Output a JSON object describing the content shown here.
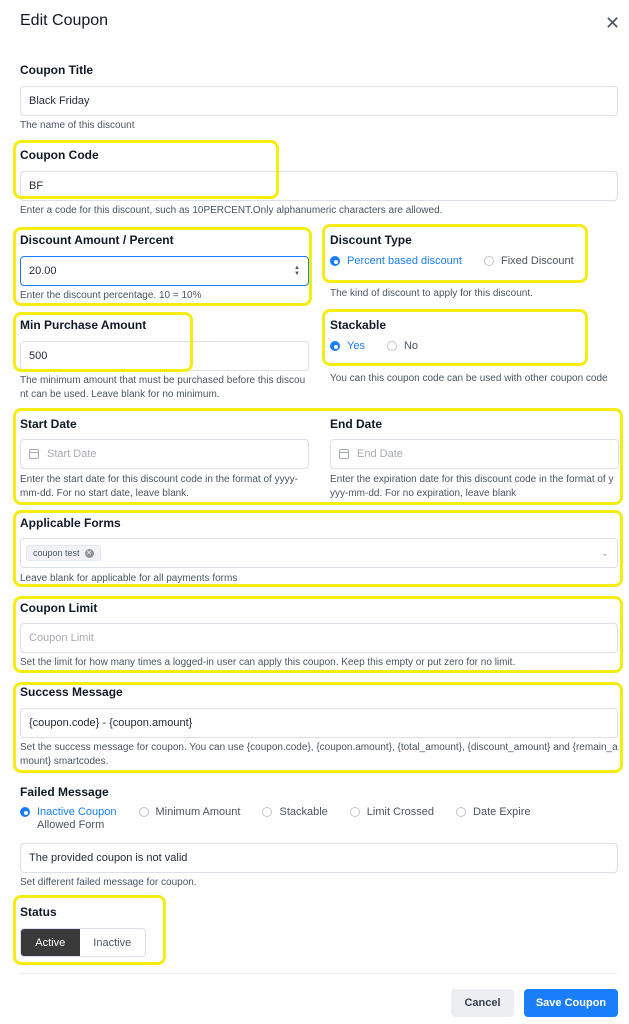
{
  "header": {
    "title": "Edit Coupon",
    "close_symbol": "✕"
  },
  "coupon_title": {
    "label": "Coupon Title",
    "value": "Black Friday",
    "help": "The name of this discount"
  },
  "coupon_code": {
    "label": "Coupon Code",
    "value": "BF",
    "help": "Enter a code for this discount, such as 10PERCENT.Only alphanumeric characters are allowed."
  },
  "discount_amount": {
    "label": "Discount Amount / Percent",
    "value": "20.00",
    "help": "Enter the discount percentage. 10 = 10%"
  },
  "discount_type": {
    "label": "Discount Type",
    "options": [
      {
        "label": "Percent based discount",
        "checked": true
      },
      {
        "label": "Fixed Discount",
        "checked": false
      }
    ],
    "help": "The kind of discount to apply for this discount."
  },
  "min_purchase": {
    "label": "Min Purchase Amount",
    "value": "500",
    "help_line1": "The minimum amount that must be purchased before this discou",
    "help_line2": "nt can be used. Leave blank for no minimum."
  },
  "stackable": {
    "label": "Stackable",
    "options": [
      {
        "label": "Yes",
        "checked": true
      },
      {
        "label": "No",
        "checked": false
      }
    ],
    "help": "You can this coupon code can be used with other coupon code"
  },
  "start_date": {
    "label": "Start Date",
    "placeholder": "Start Date",
    "help_line1": "Enter the start date for this discount code in the format of yyyy-",
    "help_line2": "mm-dd. For no start date, leave blank."
  },
  "end_date": {
    "label": "End Date",
    "placeholder": "End Date",
    "help_line1": "Enter the expiration date for this discount code in the format of y",
    "help_line2": "yyy-mm-dd. For no expiration, leave blank"
  },
  "applicable_forms": {
    "label": "Applicable Forms",
    "tag": "coupon test",
    "tag_close": "✕",
    "chevron": "⌄",
    "help": "Leave blank for applicable for all payments forms"
  },
  "coupon_limit": {
    "label": "Coupon Limit",
    "placeholder": "Coupon Limit",
    "help": "Set the limit for how many times a logged-in user can apply this coupon. Keep this empty or put zero for no limit."
  },
  "success_message": {
    "label": "Success Message",
    "value": "{coupon.code} - {coupon.amount}",
    "help_line1": "Set the success message for coupon. You can use {coupon.code}, {coupon.amount}, {total_amount}, {discount_amount} and {remain_a",
    "help_line2": "mount} smartcodes."
  },
  "failed_message": {
    "label": "Failed Message",
    "options": [
      {
        "label": "Inactive Coupon",
        "checked": true
      },
      {
        "label": "Minimum Amount",
        "checked": false
      },
      {
        "label": "Stackable",
        "checked": false
      },
      {
        "label": "Limit Crossed",
        "checked": false
      },
      {
        "label": "Date Expire",
        "checked": false
      },
      {
        "label": "Allowed Form",
        "checked": false
      }
    ],
    "value": "The provided coupon is not valid",
    "help": "Set different failed message for coupon."
  },
  "status": {
    "label": "Status",
    "options": [
      {
        "label": "Active",
        "selected": true
      },
      {
        "label": "Inactive",
        "selected": false
      }
    ]
  },
  "footer": {
    "cancel_label": "Cancel",
    "save_label": "Save Coupon"
  },
  "colors": {
    "accent": "#1a7efb",
    "highlight": "#f5ec14",
    "status_active_bg": "#3a3a3a"
  }
}
